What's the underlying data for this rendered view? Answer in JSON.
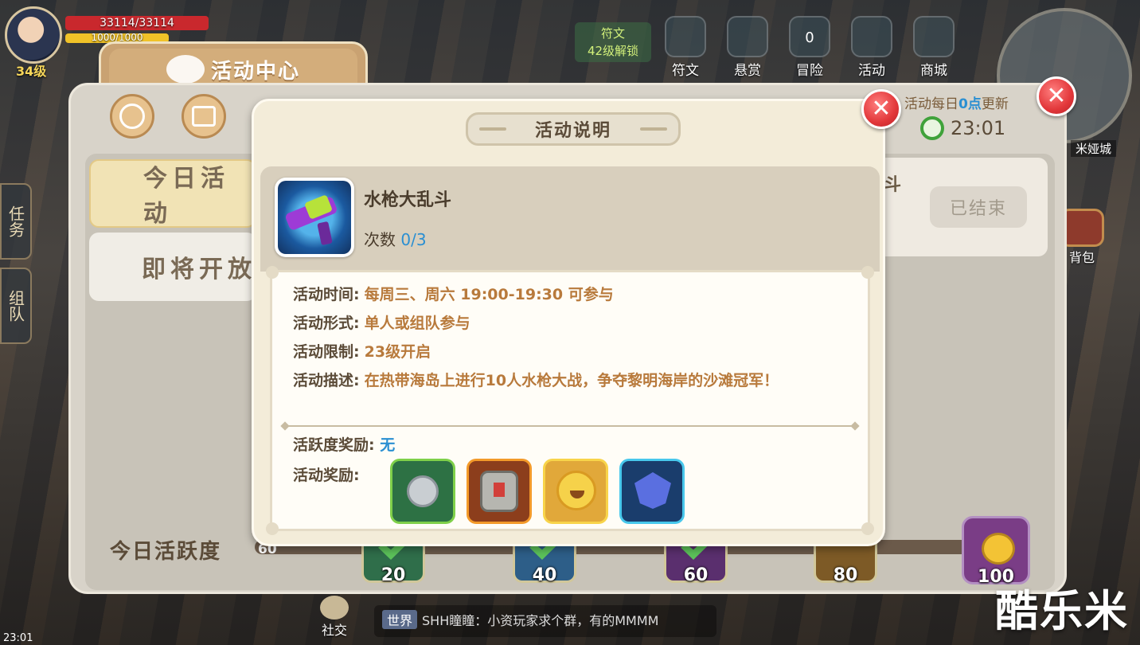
{
  "hud": {
    "hp": "33114/33114",
    "mp": "1000/1000",
    "level": "34级",
    "rune_badge_title": "符文",
    "rune_badge_sub": "42级解锁",
    "menu": [
      {
        "label": "符文",
        "icon": "rune-icon"
      },
      {
        "label": "悬赏",
        "icon": "bounty-icon"
      },
      {
        "label": "冒险",
        "icon": "adventure-icon"
      },
      {
        "label": "活动",
        "icon": "activity-icon"
      },
      {
        "label": "商城",
        "icon": "shop-icon"
      }
    ],
    "adventure_count": "0",
    "minimap_label": "米娅城",
    "bag_label": "背包",
    "side_tabs": [
      "任务",
      "组队"
    ],
    "social_label": "社交",
    "chat_tag": "世界",
    "chat_text": "SHH瞳瞳：小资玩家求个群，有的MMMM",
    "clock": "23:01",
    "watermark": "酷乐米"
  },
  "activity_center": {
    "title": "活动中心",
    "tabs": [
      "今日活动",
      "即将开放"
    ],
    "refresh_prefix": "活动每日",
    "refresh_highlight": "0点",
    "refresh_suffix": "更新",
    "timer": "23:01",
    "right_fragment": "斗",
    "ended_button": "已结束",
    "activity_label": "今日活跃度",
    "activity_start": "60",
    "milestones": [
      "20",
      "40",
      "60",
      "80",
      "100"
    ]
  },
  "modal": {
    "title": "活动说明",
    "item_name": "水枪大乱斗",
    "count_label": "次数",
    "count_value": "0/3",
    "rows": [
      {
        "key": "活动时间:",
        "value": "每周三、周六 19:00-19:30 可参与"
      },
      {
        "key": "活动形式:",
        "value": "单人或组队参与"
      },
      {
        "key": "活动限制:",
        "value": "23级开启"
      },
      {
        "key": "活动描述:",
        "value": "在热带海岛上进行10人水枪大战，争夺黎明海岸的沙滩冠军！"
      }
    ],
    "liveness_label": "活跃度奖励:",
    "liveness_value": "无",
    "rewards_label": "活动奖励:",
    "rewards": [
      {
        "icon": "silver-coins-icon",
        "frame": "green"
      },
      {
        "icon": "badge-chest-icon",
        "frame": "orange"
      },
      {
        "icon": "sun-pet-icon",
        "frame": "yellow"
      },
      {
        "icon": "blue-gem-icon",
        "frame": "blue"
      }
    ]
  },
  "colors": {
    "accent_blue": "#2a8fd2",
    "value_brown": "#b87a3c",
    "close_red": "#e2373a"
  }
}
